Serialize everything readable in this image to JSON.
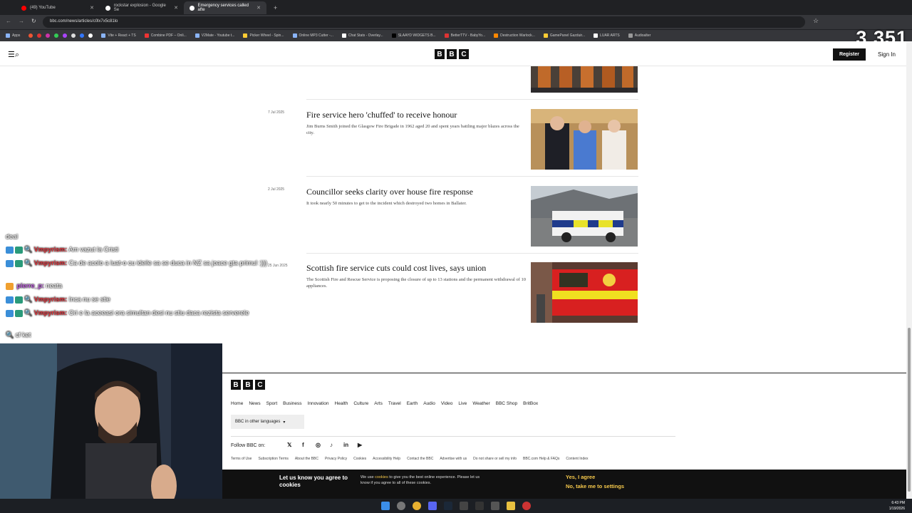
{
  "browser": {
    "tabs": [
      {
        "label": "(49) YouTube",
        "color": "#ff0000"
      },
      {
        "label": "rockstar explosion - Google Se",
        "color": "#ffffff"
      },
      {
        "label": "Emergency services called afte",
        "color": "#ffffff"
      }
    ],
    "url": "bbc.com/news/articles/c0lx7x5c81lo",
    "bookmarks": [
      "Apps",
      "Vite + React + TS",
      "Combine PDF – Onli...",
      "V2Mate - Youtube t...",
      "Picker Wheel - Spin...",
      "Online MP3 Cutter -...",
      "Chat Stats - Overlay...",
      "SLAAYD WIDGETS B...",
      "BetterTTV - BabyYo...",
      "Destruction Warlock...",
      "GamePanel Gazduir...",
      "LUAR ARTS",
      "Audioalter"
    ]
  },
  "viewer_count": "3,351",
  "bbc": {
    "logo_letters": [
      "B",
      "B",
      "C"
    ],
    "register_label": "Register",
    "signin_label": "Sign In",
    "articles": [
      {
        "date": "7 Jul 2025",
        "title": "Fire service hero 'chuffed' to receive honour",
        "summary": "Jim Burns Smith joined the Glasgow Fire Brigade in 1962 aged 20 and spent years battling major blazes across the city."
      },
      {
        "date": "2 Jul 2025",
        "title": "Councillor seeks clarity over house fire response",
        "summary": "It took nearly 50 minutes to get to the incident which destroyed two homes in Ballater."
      },
      {
        "date": "25 Jun 2025",
        "title": "Scottish fire service cuts could cost lives, says union",
        "summary": "The Scottish Fire and Rescue Service is proposing the closure of up to 13 stations and the permanent withdrawal of 10 appliances."
      }
    ],
    "footer": {
      "nav": [
        "Home",
        "News",
        "Sport",
        "Business",
        "Innovation",
        "Health",
        "Culture",
        "Arts",
        "Travel",
        "Earth",
        "Audio",
        "Video",
        "Live",
        "Weather",
        "BBC Shop",
        "BritBox"
      ],
      "language_button": "BBC in other languages",
      "follow_label": "Follow BBC on:",
      "legal": [
        "Terms of Use",
        "Subscription Terms",
        "About the BBC",
        "Privacy Policy",
        "Cookies",
        "Accessibility Help",
        "Contact the BBC",
        "Advertise with us",
        "Do not share or sell my info",
        "BBC.com Help & FAQs",
        "Content Index"
      ]
    },
    "cookie": {
      "title": "Let us know you agree to cookies",
      "text_before": "We use ",
      "text_link": "cookies",
      "text_after": " to give you the best online experience. Please let us know if you agree to all of these cookies.",
      "yes": "Yes, I agree",
      "no": "No, take me to settings"
    }
  },
  "chat": [
    {
      "nick": "",
      "msg": "deal"
    },
    {
      "nick": "Vmpyrism:",
      "msg": "Am vazut la Cristi"
    },
    {
      "nick": "Vmpyrism:",
      "msg": "Ca de acolo a luat-o cu ideile sa se duca in NZ sa joace gta primul :)))"
    },
    {
      "nick": "pierre_p:",
      "msg": "neata"
    },
    {
      "nick": "Vmpyrism:",
      "msg": "Inca nu se stie"
    },
    {
      "nick": "Vmpyrism:",
      "msg": "Ori e la aceeasi ora simultan desi nu stiu daca rezista serverele"
    },
    {
      "nick": "",
      "msg": "cf ket"
    }
  ],
  "clock": {
    "time": "6:43 PM",
    "date": "1/19/2026"
  }
}
